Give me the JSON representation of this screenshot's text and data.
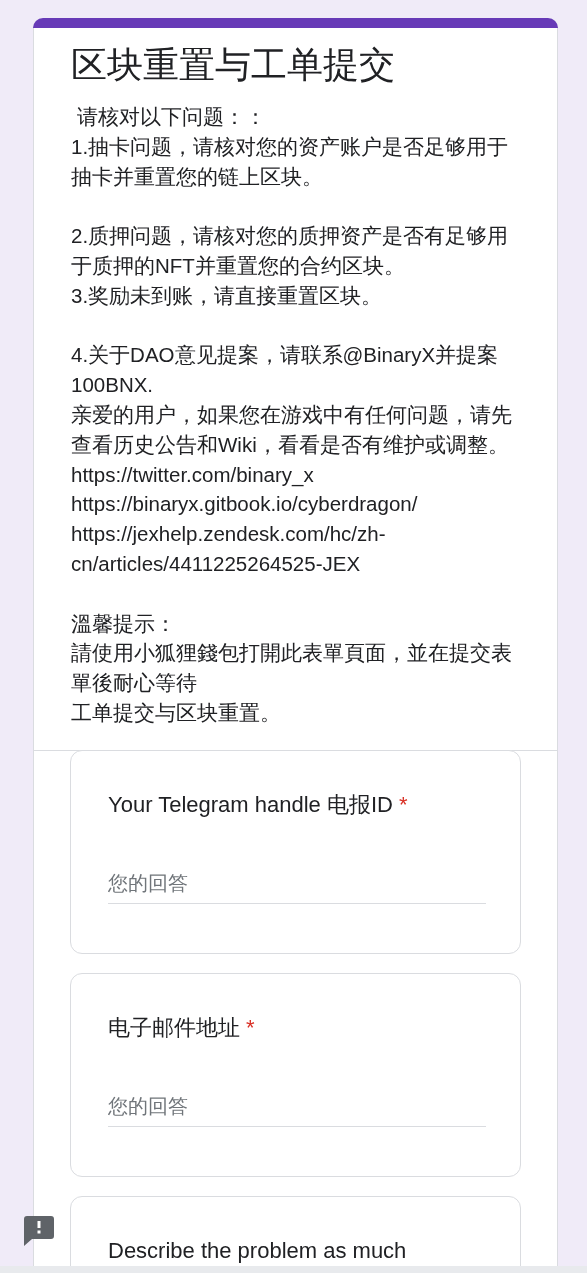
{
  "form": {
    "title": "区块重置与工单提交",
    "description_blocks": [
      {
        "lines": [
          " 请核对以下问题：：",
          "1.抽卡问题，请核对您的资产账户是否足够用于抽卡并重置您的链上区块。"
        ]
      },
      {
        "lines": [
          "2.质押问题，请核对您的质押资产是否有足够用于质押的NFT并重置您的合约区块。",
          "3.奖励未到账，请直接重置区块。"
        ]
      },
      {
        "lines": [
          "4.关于DAO意见提案，请联系@BinaryX并提案100BNX.",
          "亲爱的用户，如果您在游戏中有任何问题，请先查看历史公告和Wiki，看看是否有维护或调整。",
          "https://twitter.com/binary_x",
          "https://binaryx.gitbook.io/cyberdragon/",
          "https://jexhelp.zendesk.com/hc/zh-cn/articles/4411225264525-JEX"
        ]
      },
      {
        "lines": [
          "溫馨提示：",
          "請使用小狐狸錢包打開此表單頁面，並在提交表單後耐心等待",
          "工单提交与区块重置。"
        ]
      }
    ]
  },
  "questions": [
    {
      "title": "Your Telegram handle 电报ID",
      "required_mark": "*",
      "placeholder": "您的回答"
    },
    {
      "title": "电子邮件地址",
      "required_mark": "*",
      "placeholder": "您的回答"
    },
    {
      "title": "Describe the problem as much"
    }
  ]
}
